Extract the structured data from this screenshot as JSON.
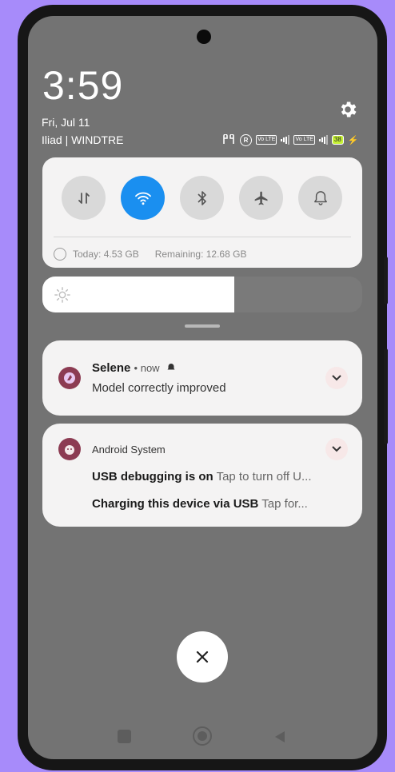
{
  "status": {
    "time": "3:59",
    "date": "Fri, Jul 11",
    "carrier": "Iliad | WINDTRE",
    "volte_label_1": "Vo LTE",
    "volte_label_2": "Vo LTE",
    "roaming_badge": "R",
    "battery": "38"
  },
  "quick_settings": {
    "toggles": [
      {
        "name": "mobile-data",
        "icon": "data-arrows-icon",
        "active": false
      },
      {
        "name": "wifi",
        "icon": "wifi-icon",
        "active": true
      },
      {
        "name": "bluetooth",
        "icon": "bluetooth-icon",
        "active": false
      },
      {
        "name": "airplane",
        "icon": "airplane-icon",
        "active": false
      },
      {
        "name": "sound",
        "icon": "bell-icon",
        "active": false
      }
    ],
    "data_today": "Today: 4.53 GB",
    "data_remaining": "Remaining: 12.68 GB",
    "brightness_level": 0.6
  },
  "notifications": [
    {
      "app": "Selene",
      "time": "• now",
      "text": "Model correctly improved"
    },
    {
      "app": "Android System",
      "lines": [
        {
          "title": "USB debugging is on",
          "text": "Tap to turn off U..."
        },
        {
          "title": "Charging this device via USB",
          "text": "Tap for..."
        }
      ]
    }
  ],
  "colors": {
    "accent": "#1a8ff0",
    "background": "#a78bfa",
    "app_icon": "#8c3b52"
  }
}
